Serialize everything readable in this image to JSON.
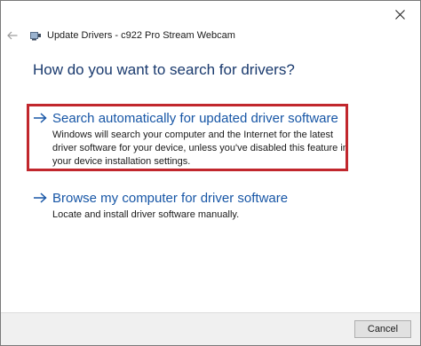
{
  "window": {
    "title": "Update Drivers - c922 Pro Stream Webcam"
  },
  "main": {
    "heading": "How do you want to search for drivers?",
    "options": [
      {
        "label": "Search automatically for updated driver software",
        "description": "Windows will search your computer and the Internet for the latest driver software for your device, unless you've disabled this feature in your device installation settings."
      },
      {
        "label": "Browse my computer for driver software",
        "description": "Locate and install driver software manually."
      }
    ]
  },
  "footer": {
    "cancel_label": "Cancel"
  },
  "icons": {
    "close": "close-icon",
    "back": "back-arrow-icon",
    "device": "device-manager-icon",
    "option_arrow": "right-arrow-icon"
  },
  "colors": {
    "heading": "#1a3a6e",
    "link": "#1756a6",
    "highlight": "#c1272d",
    "footer_bg": "#f0f0f0"
  }
}
